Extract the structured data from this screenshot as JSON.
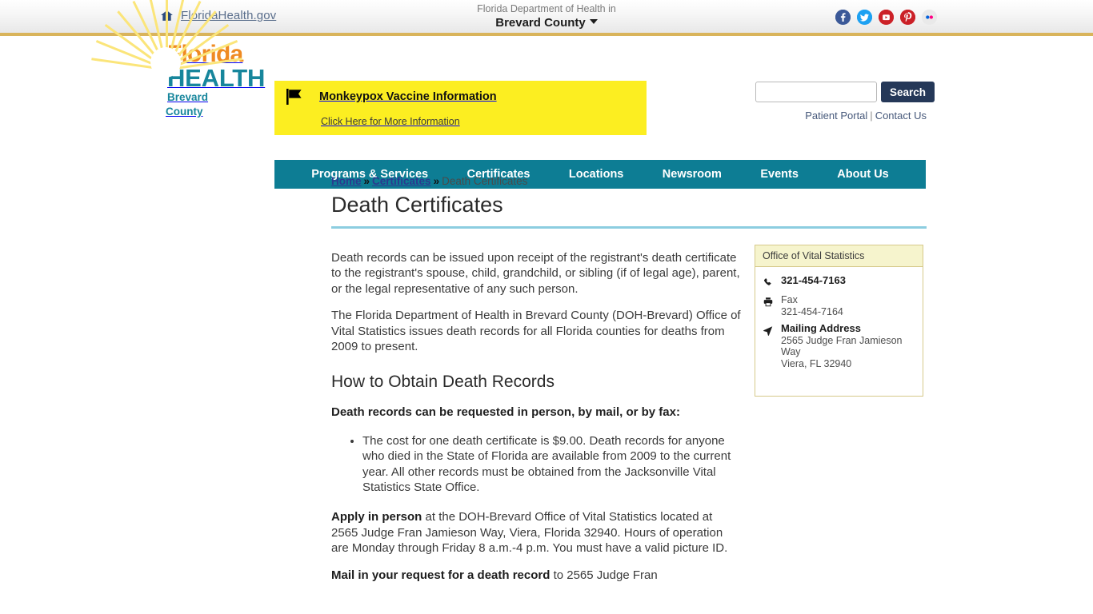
{
  "topbar": {
    "home_icon": "home-icon",
    "site_link": "FloridaHealth.gov",
    "dept_prefix": "Florida Department of Health in",
    "county": "Brevard County",
    "socials": [
      {
        "name": "facebook-icon",
        "label": "Facebook",
        "color": "#3b5998"
      },
      {
        "name": "twitter-icon",
        "label": "Twitter",
        "color": "#1da1f2"
      },
      {
        "name": "youtube-icon",
        "label": "YouTube",
        "color": "#cc2127"
      },
      {
        "name": "pinterest-icon",
        "label": "Pinterest",
        "color": "#cb2027"
      },
      {
        "name": "flickr-icon",
        "label": "Flickr",
        "color": "#e8e8e8"
      }
    ]
  },
  "logo": {
    "line1": "Florida",
    "line2": "HEALTH",
    "line3": "Brevard County",
    "orange": "#ef8a22",
    "teal": "#17869c",
    "sun_yellow": "#f7d117"
  },
  "alert": {
    "icon": "flag-icon",
    "title": "Monkeypox Vaccine Information",
    "subtitle": "Click Here for More Information",
    "background": "#fcee21"
  },
  "search": {
    "value": "",
    "placeholder": "",
    "button_label": "Search"
  },
  "util": {
    "patient_portal": "Patient Portal",
    "separator": "|",
    "contact_us": "Contact Us"
  },
  "nav": {
    "accent": "#0d7d94",
    "items": [
      {
        "label": "Programs & Services"
      },
      {
        "label": "Certificates"
      },
      {
        "label": "Locations"
      },
      {
        "label": "Newsroom"
      },
      {
        "label": "Events"
      },
      {
        "label": "About Us"
      }
    ]
  },
  "breadcrumb": {
    "home": "Home",
    "sep1": "»",
    "certificates": "Certificates",
    "sep2": "»",
    "current": "Death Certificates"
  },
  "page": {
    "title": "Death Certificates",
    "title_rule_color": "#8ccde0",
    "para1": "Death records can be issued upon receipt of the registrant's death certificate to the registrant's spouse, child, grandchild, or sibling (if of legal age),  parent, or the legal representative of any such person.",
    "para2": "The Florida Department of Health in Brevard County (DOH-Brevard) Office of Vital Statistics issues death records for all Florida counties for deaths from 2009 to present.",
    "heading2": "How to Obtain Death Records",
    "lead": "Death records can be requested in person, by mail, or by fax:",
    "bullets": [
      "The cost for one death certificate is $9.00. Death records for anyone who died in the State of Florida are available from 2009 to the current year. All other records must be obtained from the Jacksonville Vital Statistics State Office."
    ],
    "apply_bold": "Apply in person",
    "apply_rest": " at the DOH-Brevard Office of Vital Statistics located at 2565 Judge Fran Jamieson Way, Viera, Florida 32940. Hours of operation are Monday through Friday 8 a.m.-4 p.m. You must have a valid picture ID.",
    "mail_bold": "Mail in your request for a death record",
    "mail_rest": " to 2565 Judge Fran"
  },
  "vital_card": {
    "header": "Office of Vital Statistics",
    "phone_icon": "phone-icon",
    "phone": "321-454-7163",
    "fax_icon": "fax-icon",
    "fax_label": "Fax",
    "fax_number": "321-454-7164",
    "address_icon": "location-arrow-icon",
    "address_label": "Mailing Address",
    "address_line1": "2565 Judge Fran Jamieson Way",
    "address_line2": "Viera, FL 32940"
  }
}
